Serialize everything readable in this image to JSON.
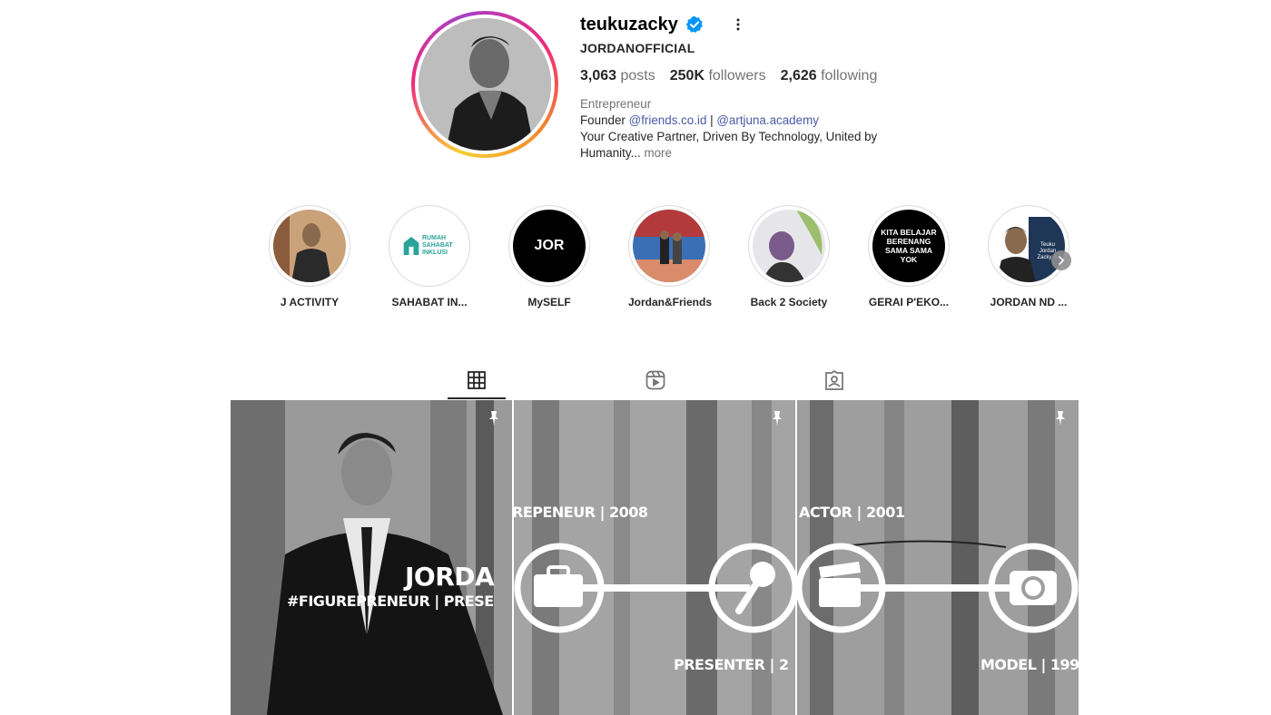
{
  "profile": {
    "username": "teukuzacky",
    "full_name": "JORDANOFFICIAL",
    "verified": true,
    "stats": {
      "posts_count": "3,063",
      "posts_label": "posts",
      "followers_count": "250K",
      "followers_label": "followers",
      "following_count": "2,626",
      "following_label": "following"
    },
    "bio": {
      "category": "Entrepreneur",
      "line_prefix": "Founder ",
      "link1": "@friends.co.id",
      "separator": " | ",
      "link2": "@artjuna.academy",
      "text": "Your Creative Partner, Driven By Technology, United by Humanity...",
      "more": " more"
    }
  },
  "highlights": [
    {
      "label": "J ACTIVITY"
    },
    {
      "label": "SAHABAT IN...",
      "inner_text": "RUMAH SAHABAT INKLUSI"
    },
    {
      "label": "MySELF",
      "inner_text": "JOR"
    },
    {
      "label": "Jordan&Friends"
    },
    {
      "label": "Back 2 Society"
    },
    {
      "label": "GERAI P'EKO...",
      "inner_text": "KITA BELAJAR BERENANG SAMA SAMA YOK"
    },
    {
      "label": "JORDAN ND ...",
      "inner_text": "Teuku Jordan Zacky A."
    }
  ],
  "tabs": [
    {
      "name": "posts",
      "icon": "grid-icon",
      "active": true
    },
    {
      "name": "reels",
      "icon": "reels-icon",
      "active": false
    },
    {
      "name": "tagged",
      "icon": "tagged-icon",
      "active": false
    }
  ],
  "posts": [
    {
      "pinned": true,
      "overlay_line1": "JORDA",
      "overlay_line2": "#FIGUREPRENEUR | PRESE"
    },
    {
      "pinned": true,
      "overlay_top": "REPENEUR | 2008",
      "overlay_bottom": "PRESENTER | 2"
    },
    {
      "pinned": true,
      "overlay_top": "ACTOR | 2001",
      "overlay_bottom": "MODEL | 199"
    }
  ],
  "colors": {
    "verified_blue": "#0095f6",
    "link_color": "#4a5aa8",
    "secondary_text": "#737373"
  }
}
